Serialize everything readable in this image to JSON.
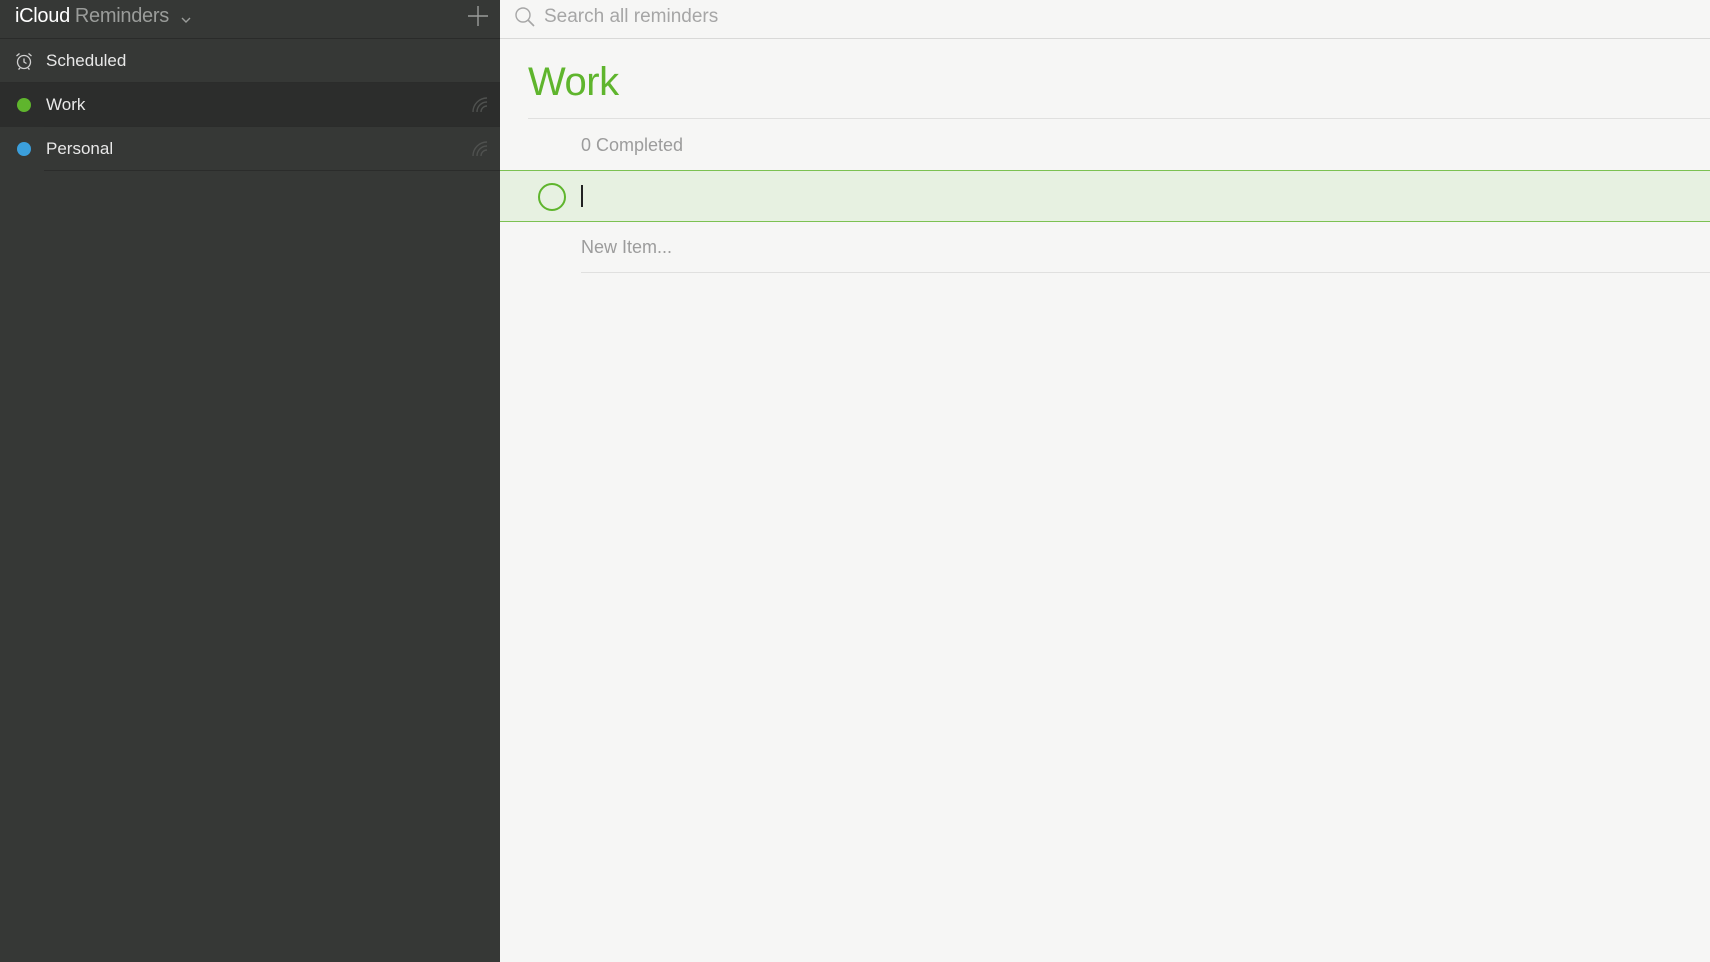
{
  "app": {
    "brand_primary": "iCloud",
    "brand_secondary": "Reminders",
    "chevron_icon": "chevron-down-icon",
    "add_icon": "plus-icon"
  },
  "sidebar": {
    "items": [
      {
        "label": "Scheduled",
        "icon": "alarm-clock-icon"
      },
      {
        "label": "Work",
        "color": "#5fb52d",
        "selected": true,
        "shared_icon": "rss-feed-icon"
      },
      {
        "label": "Personal",
        "color": "#3b9fdc",
        "selected": false,
        "shared_icon": "rss-feed-icon"
      }
    ]
  },
  "search": {
    "placeholder": "Search all reminders",
    "value": ""
  },
  "list": {
    "title": "Work",
    "accent_color": "#5fb52d",
    "completed_label": "0 Completed",
    "active_item_value": "",
    "new_item_placeholder": "New Item..."
  },
  "colors": {
    "sidebar_bg": "#363836",
    "main_bg": "#f6f6f5",
    "accent_green": "#5fb52d",
    "personal_blue": "#3b9fdc"
  }
}
